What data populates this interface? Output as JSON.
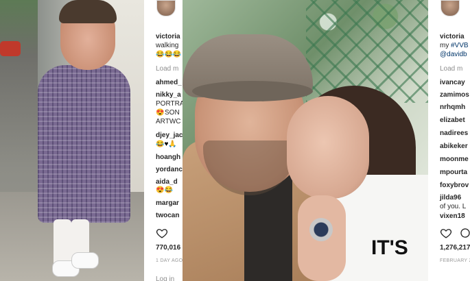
{
  "panel_a": {
    "username": "victoria",
    "caption": "walking",
    "caption_emojis": "😂😂😂",
    "load_more": "Load m",
    "comments": [
      {
        "user": "ahmed_"
      },
      {
        "user": "nikky_a"
      },
      {
        "user": "PORTRA"
      },
      {
        "user": "SON",
        "prefix_emoji": "😍"
      },
      {
        "user": "ARTWC"
      },
      {
        "user": "djey_jac"
      },
      {
        "user": "",
        "emojis": "😂♥🙏"
      },
      {
        "user": "hoangh"
      },
      {
        "user": "yordanc"
      },
      {
        "user": "aida_d"
      },
      {
        "user": "",
        "emojis": "😍😂"
      },
      {
        "user": "margar"
      },
      {
        "user": "twocan"
      }
    ],
    "likes": "770,016",
    "date": "1 DAY AGO",
    "login": "Log in"
  },
  "panel_b": {
    "username": "victoria",
    "caption_line": "my",
    "hashtag": "#VVB",
    "mention": "@davidb",
    "load_more": "Load m",
    "comments": [
      {
        "user": "ivancay"
      },
      {
        "user": "zamimos"
      },
      {
        "user": "nrhqmh"
      },
      {
        "user": "elizabet"
      },
      {
        "user": "nadirees"
      },
      {
        "user": "abikeker"
      },
      {
        "user": "moonme"
      },
      {
        "user": "mpourta"
      },
      {
        "user": "foxybrov"
      },
      {
        "user": "jilda96"
      },
      {
        "user": "of you. L"
      },
      {
        "user": "vixen18"
      }
    ],
    "likes": "1,276,217",
    "date": "FEBRUARY 2"
  },
  "center_photo": {
    "shirt_text": "IT'S"
  },
  "colors": {
    "link": "#003569",
    "text": "#262626",
    "muted": "#8e8e8e"
  }
}
